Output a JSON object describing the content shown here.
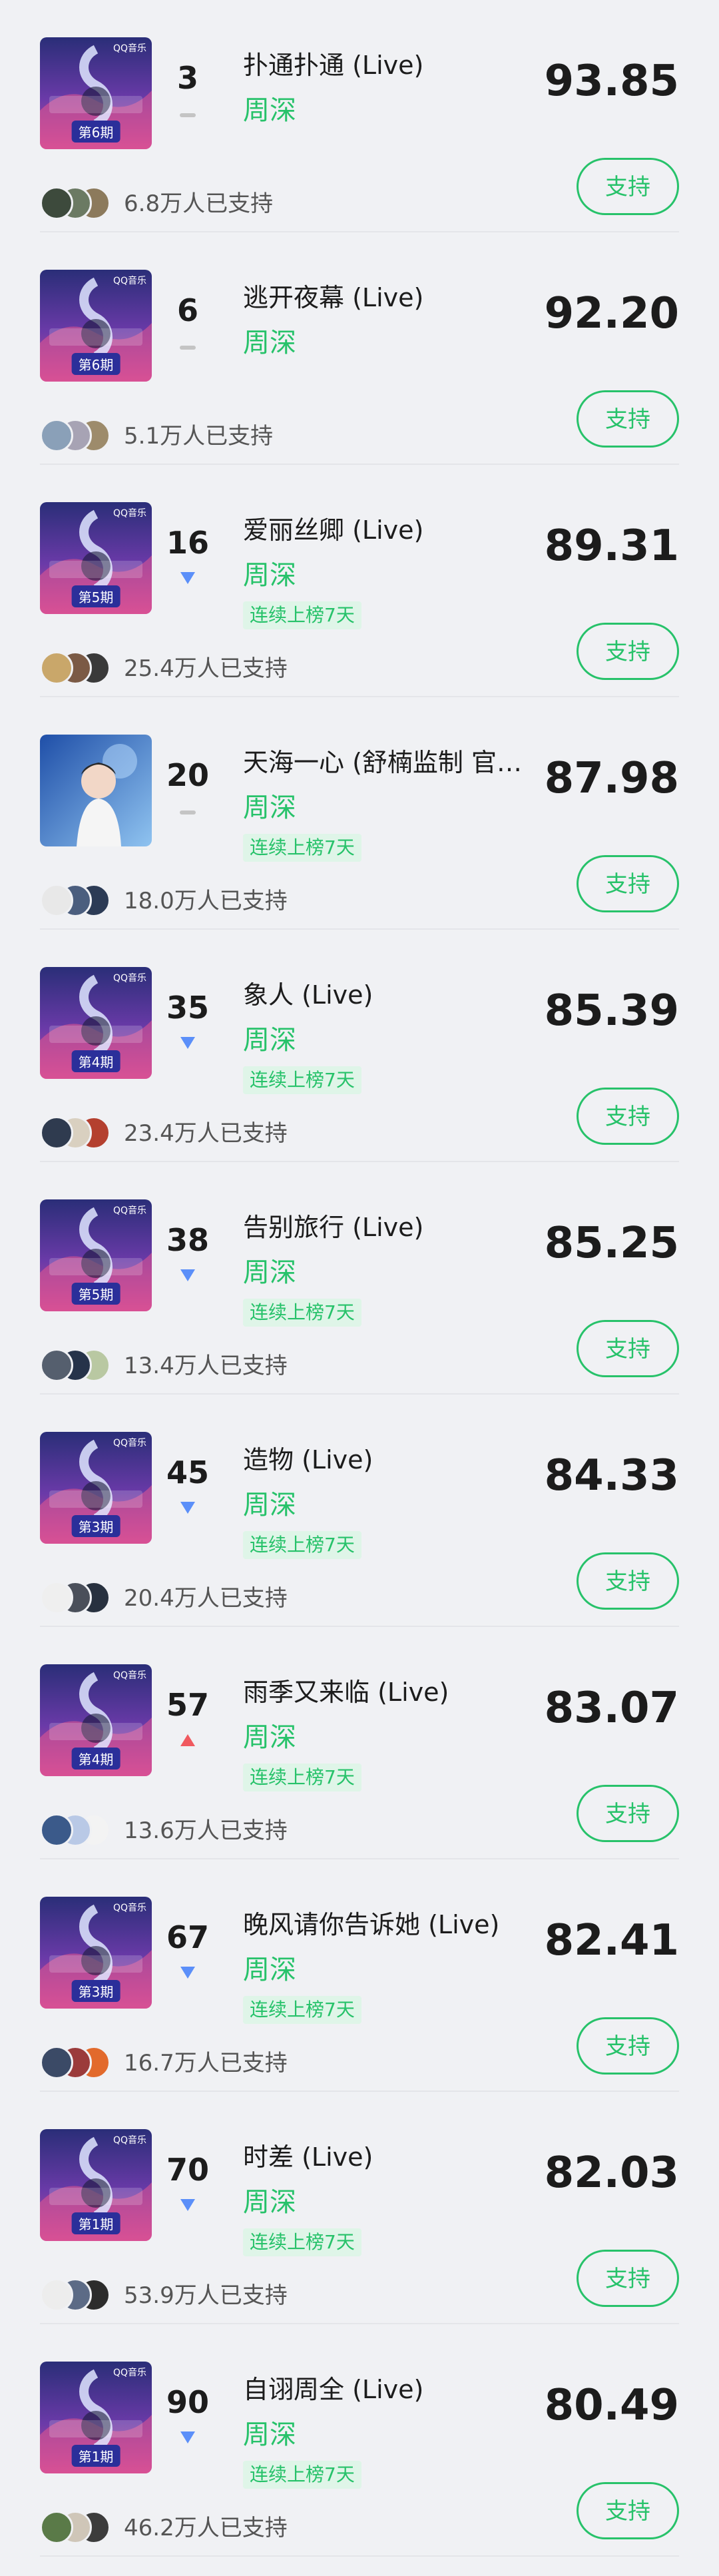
{
  "colors": {
    "accent": "#27c26a",
    "accent_bg": "#dff5e8",
    "trend_down": "#5b8ff9",
    "trend_up": "#f0595f",
    "trend_flat": "#c4c4c4",
    "background": "#f0f1f4"
  },
  "support_label": "支持",
  "items": [
    {
      "rank": "3",
      "trend": "flat",
      "title": "扑通扑通 (Live)",
      "artist": "周深",
      "streak": "",
      "score": "93.85",
      "supporters": "6.8万人已支持",
      "cover": "show-ep6",
      "avatars": [
        "#3d4a3c",
        "#6b7a63",
        "#8c7a5c"
      ]
    },
    {
      "rank": "6",
      "trend": "flat",
      "title": "逃开夜幕 (Live)",
      "artist": "周深",
      "streak": "",
      "score": "92.20",
      "supporters": "5.1万人已支持",
      "cover": "show-ep6",
      "avatars": [
        "#8aa0b8",
        "#a7a3b4",
        "#9d8b6b"
      ]
    },
    {
      "rank": "16",
      "trend": "down",
      "title": "爱丽丝卿 (Live)",
      "artist": "周深",
      "streak": "连续上榜7天",
      "score": "89.31",
      "supporters": "25.4万人已支持",
      "cover": "show-ep5",
      "avatars": [
        "#c9a76a",
        "#7b5a45",
        "#3a3a3a"
      ]
    },
    {
      "rank": "20",
      "trend": "flat",
      "title": "天海一心 (舒楠监制 官方原唱版)",
      "artist": "周深",
      "streak": "连续上榜7天",
      "score": "87.98",
      "supporters": "18.0万人已支持",
      "cover": "portrait",
      "avatars": [
        "#e8e8e8",
        "#4b5e7e",
        "#2c3b55"
      ]
    },
    {
      "rank": "35",
      "trend": "down",
      "title": "象人 (Live)",
      "artist": "周深",
      "streak": "连续上榜7天",
      "score": "85.39",
      "supporters": "23.4万人已支持",
      "cover": "show-ep4",
      "avatars": [
        "#2f3b4f",
        "#d9d0c0",
        "#b4402f"
      ]
    },
    {
      "rank": "38",
      "trend": "down",
      "title": "告别旅行 (Live)",
      "artist": "周深",
      "streak": "连续上榜7天",
      "score": "85.25",
      "supporters": "13.4万人已支持",
      "cover": "show-ep5",
      "avatars": [
        "#555f6e",
        "#26334a",
        "#b9c8a2"
      ]
    },
    {
      "rank": "45",
      "trend": "down",
      "title": "造物 (Live)",
      "artist": "周深",
      "streak": "连续上榜7天",
      "score": "84.33",
      "supporters": "20.4万人已支持",
      "cover": "show-ep3",
      "avatars": [
        "#efefef",
        "#4a4f5a",
        "#28313f"
      ]
    },
    {
      "rank": "57",
      "trend": "up",
      "title": "雨季又来临 (Live)",
      "artist": "周深",
      "streak": "连续上榜7天",
      "score": "83.07",
      "supporters": "13.6万人已支持",
      "cover": "show-ep4",
      "avatars": [
        "#3b5a8a",
        "#b9c9e6",
        "#f3f3f3"
      ]
    },
    {
      "rank": "67",
      "trend": "down",
      "title": "晚风请你告诉她 (Live)",
      "artist": "周深",
      "streak": "连续上榜7天",
      "score": "82.41",
      "supporters": "16.7万人已支持",
      "cover": "show-ep3",
      "avatars": [
        "#3b4a66",
        "#9b3b3b",
        "#e26a2c"
      ]
    },
    {
      "rank": "70",
      "trend": "down",
      "title": "时差 (Live)",
      "artist": "周深",
      "streak": "连续上榜7天",
      "score": "82.03",
      "supporters": "53.9万人已支持",
      "cover": "show-ep1",
      "avatars": [
        "#ededed",
        "#5c6b86",
        "#2c2c2c"
      ]
    },
    {
      "rank": "90",
      "trend": "down",
      "title": "自诩周全 (Live)",
      "artist": "周深",
      "streak": "连续上榜7天",
      "score": "80.49",
      "supporters": "46.2万人已支持",
      "cover": "show-ep1",
      "avatars": [
        "#5a7a48",
        "#cfc6b8",
        "#3c3c3c"
      ]
    }
  ],
  "cover_badges": {
    "show-ep6": {
      "logo": "QQ音乐",
      "episode": "第6期"
    },
    "show-ep5": {
      "logo": "QQ音乐",
      "episode": "第5期"
    },
    "show-ep4": {
      "logo": "QQ音乐",
      "episode": "第4期"
    },
    "show-ep3": {
      "logo": "QQ音乐",
      "episode": "第3期"
    },
    "show-ep1": {
      "logo": "QQ音乐",
      "episode": "第1期"
    },
    "portrait": {
      "logo": "",
      "episode": ""
    }
  }
}
